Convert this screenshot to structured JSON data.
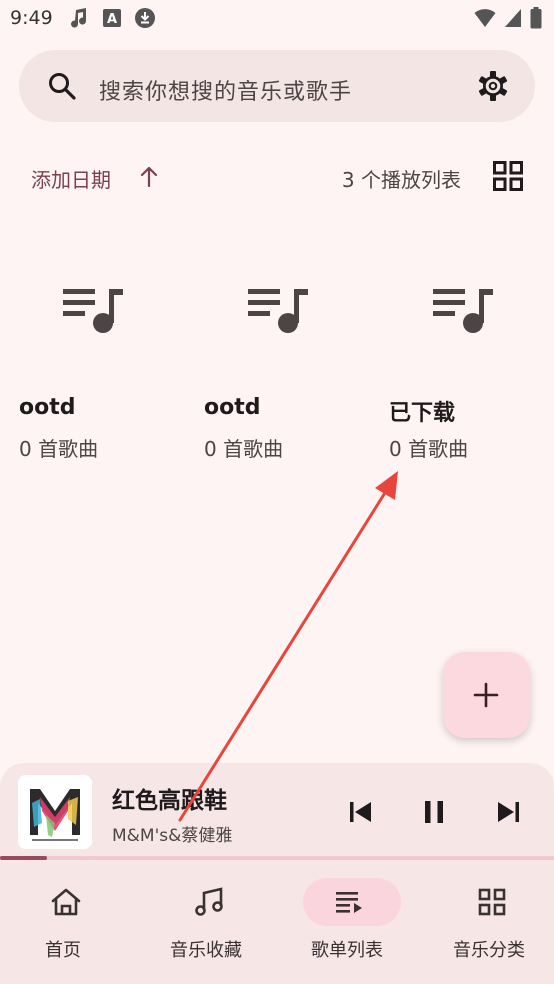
{
  "status_bar": {
    "time": "9:49"
  },
  "search": {
    "placeholder": "搜索你想搜的音乐或歌手"
  },
  "sort": {
    "label": "添加日期",
    "playlist_count": "3 个播放列表"
  },
  "playlists": [
    {
      "name": "ootd",
      "count": "0 首歌曲"
    },
    {
      "name": "ootd",
      "count": "0 首歌曲"
    },
    {
      "name": "已下载",
      "count": "0 首歌曲"
    }
  ],
  "now_playing": {
    "title": "红色高跟鞋",
    "artist": "M&M's&蔡健雅",
    "progress": 0.085
  },
  "bottom_nav": {
    "items": [
      {
        "label": "首页",
        "icon": "home-icon",
        "active": false
      },
      {
        "label": "音乐收藏",
        "icon": "music-note-icon",
        "active": false
      },
      {
        "label": "歌单列表",
        "icon": "playlist-icon",
        "active": true
      },
      {
        "label": "音乐分类",
        "icon": "category-grid-icon",
        "active": false
      }
    ]
  },
  "colors": {
    "accent": "#7a4154",
    "background": "#fdf4f3",
    "surface": "#f6e7e6",
    "active_pill": "#fbd5dd",
    "annotation": "#e8463c"
  }
}
